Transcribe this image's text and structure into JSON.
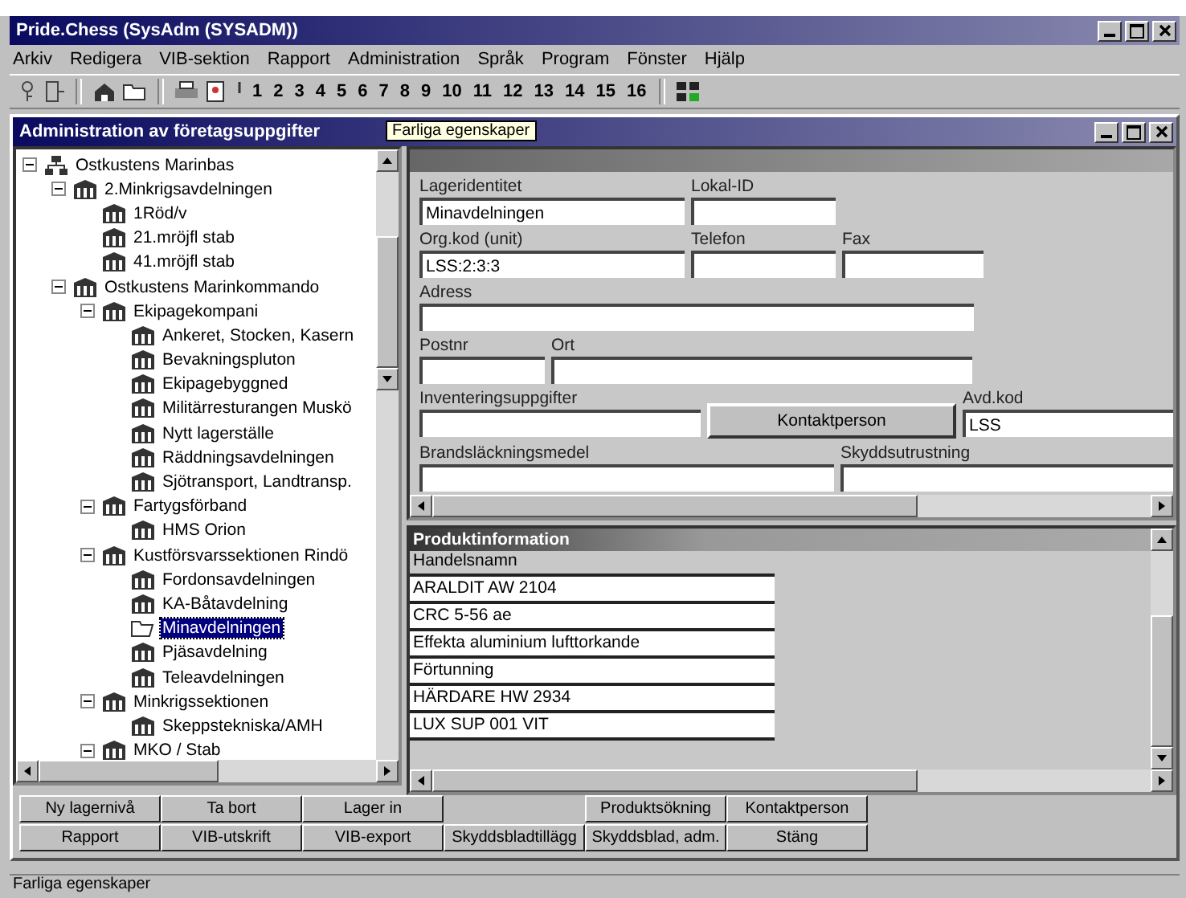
{
  "window": {
    "title": "Pride.Chess (SysAdm (SYSADM))"
  },
  "menu": [
    "Arkiv",
    "Redigera",
    "VIB-sektion",
    "Rapport",
    "Administration",
    "Språk",
    "Program",
    "Fönster",
    "Hjälp"
  ],
  "toolbar": {
    "numbers": [
      "1",
      "2",
      "3",
      "4",
      "5",
      "6",
      "7",
      "8",
      "9",
      "10",
      "11",
      "12",
      "13",
      "14",
      "15",
      "16"
    ]
  },
  "child_window": {
    "title": "Administration av företagsuppgifter",
    "tooltip": "Farliga egenskaper"
  },
  "tree": [
    {
      "label": "Ostkustens Marinbas",
      "expanded": true,
      "selected": false,
      "children": [
        {
          "label": "2.Minkrigsavdelningen",
          "expanded": true,
          "selected": false,
          "children": [
            {
              "label": "1Röd/v",
              "selected": false
            },
            {
              "label": "21.mröjfl stab",
              "selected": false
            },
            {
              "label": "41.mröjfl stab",
              "selected": false
            }
          ]
        },
        {
          "label": "Ostkustens Marinkommando",
          "expanded": true,
          "selected": false,
          "children": [
            {
              "label": "Ekipagekompani",
              "expanded": true,
              "selected": false,
              "children": [
                {
                  "label": "Ankeret, Stocken, Kasern",
                  "selected": false
                },
                {
                  "label": "Bevakningspluton",
                  "selected": false
                },
                {
                  "label": "Ekipagebyggned",
                  "selected": false
                },
                {
                  "label": "Militärresturangen Muskö",
                  "selected": false
                },
                {
                  "label": "Nytt lagerställe",
                  "selected": false
                },
                {
                  "label": "Räddningsavdelningen",
                  "selected": false
                },
                {
                  "label": "Sjötransport, Landtransp.",
                  "selected": false
                }
              ]
            },
            {
              "label": "Fartygsförband",
              "expanded": true,
              "selected": false,
              "children": [
                {
                  "label": "HMS Orion",
                  "selected": false
                }
              ]
            },
            {
              "label": "Kustförsvarssektionen Rindö",
              "expanded": true,
              "selected": false,
              "children": [
                {
                  "label": "Fordonsavdelningen",
                  "selected": false
                },
                {
                  "label": "KA-Båtavdelning",
                  "selected": false
                },
                {
                  "label": "Minavdelningen",
                  "selected": true
                },
                {
                  "label": "Pjäsavdelning",
                  "selected": false
                },
                {
                  "label": "Teleavdelningen",
                  "selected": false
                }
              ]
            },
            {
              "label": "Minkrigssektionen",
              "expanded": true,
              "selected": false,
              "children": [
                {
                  "label": "Skeppstekniska/AMH",
                  "selected": false
                }
              ]
            },
            {
              "label": "MKO / Stab",
              "expanded": true,
              "selected": false
            }
          ]
        }
      ]
    }
  ],
  "form": {
    "fields": [
      {
        "kind": "field",
        "label": "Lageridentitet",
        "value": "Minavdelningen"
      },
      {
        "kind": "field",
        "label": "Lokal-ID"
      },
      {
        "kind": "field",
        "label": "Org.kod (unit)",
        "value": "LSS:2:3:3"
      },
      {
        "kind": "field",
        "label": "Telefon"
      },
      {
        "kind": "field",
        "label": "Fax"
      },
      {
        "kind": "field",
        "label": "Adress"
      },
      {
        "kind": "field",
        "label": "Postnr"
      },
      {
        "kind": "field",
        "label": "Ort"
      },
      {
        "kind": "field",
        "label": "Inventeringsuppgifter"
      },
      {
        "kind": "button",
        "label": "Kontaktperson"
      },
      {
        "kind": "field",
        "label": "Avd.kod",
        "value": "LSS"
      },
      {
        "kind": "field",
        "label": "Brandsläckningsmedel"
      },
      {
        "kind": "field",
        "label": "Skyddsutrustning"
      }
    ]
  },
  "products": {
    "title": "Produktinformation",
    "column": "Handelsnamn",
    "rows": [
      "ARALDIT AW 2104",
      "CRC 5-56 ae",
      "Effekta aluminium lufttorkande",
      "Förtunning",
      "HÄRDARE HW 2934",
      "LUX SUP 001 VIT"
    ]
  },
  "buttons": [
    [
      {
        "kind": "button",
        "label": "Ny lagernivå"
      },
      {
        "kind": "button",
        "label": "Ta bort"
      },
      {
        "kind": "button",
        "label": "Lager in"
      },
      {
        "kind": "spacer"
      },
      {
        "kind": "button",
        "label": "Produktsökning"
      },
      {
        "kind": "button",
        "label": "Kontaktperson"
      }
    ],
    [
      {
        "kind": "button",
        "label": "Rapport"
      },
      {
        "kind": "button",
        "label": "VIB-utskrift"
      },
      {
        "kind": "button",
        "label": "VIB-export"
      },
      {
        "kind": "button",
        "label": "Skyddsbladtillägg"
      },
      {
        "kind": "button",
        "label": "Skyddsblad, adm."
      },
      {
        "kind": "button",
        "label": "Stäng"
      }
    ]
  ],
  "status_bar": "Farliga egenskaper"
}
